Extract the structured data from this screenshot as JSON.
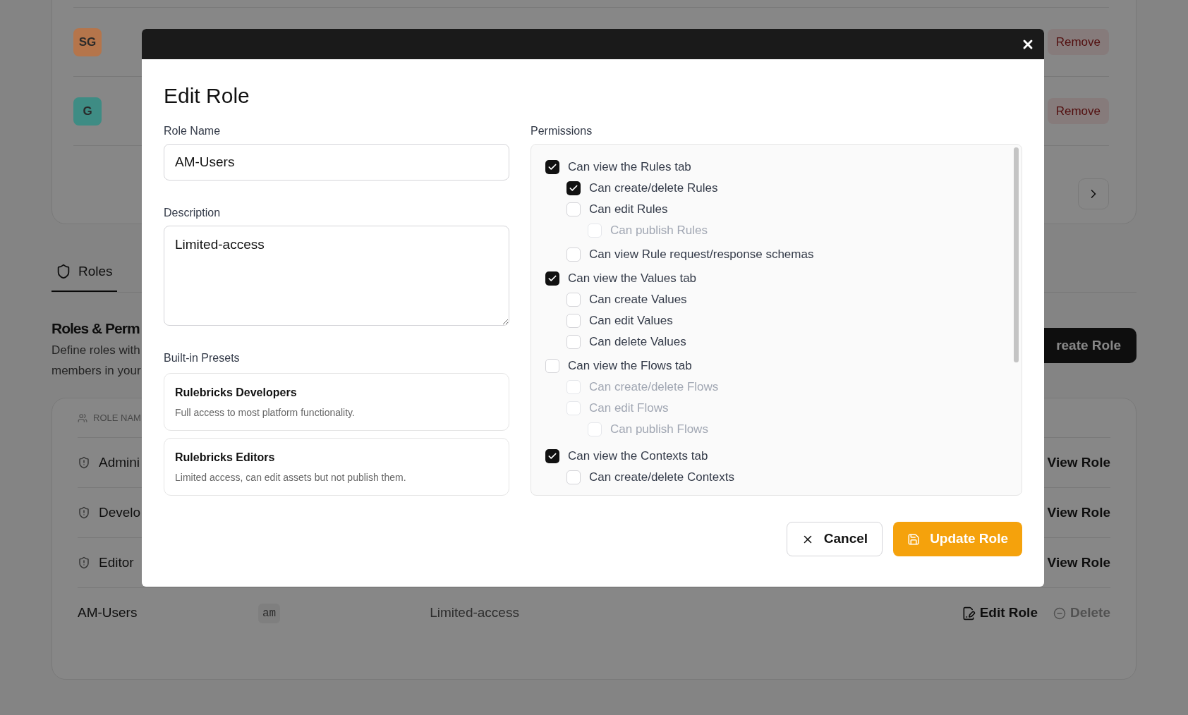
{
  "background": {
    "members": [
      {
        "initials": "SG",
        "color": "#b5754b",
        "action": "Remove"
      },
      {
        "initials": "G",
        "color": "#3e8c84",
        "action": "Remove"
      }
    ],
    "tabs": [
      {
        "label": "Roles",
        "selected": true
      }
    ],
    "section": {
      "title": "Roles & Perm",
      "description_lines": [
        "Define roles with",
        "members in your"
      ],
      "create_button": "reate Role"
    },
    "table": {
      "column_1": "ROLE NAM",
      "rows": [
        {
          "kind": "builtin",
          "name": "Admini",
          "action": "View Role"
        },
        {
          "kind": "builtin",
          "name": "Develo",
          "action": "View Role"
        },
        {
          "kind": "builtin",
          "name": "Editor",
          "action": "View Role"
        },
        {
          "kind": "custom",
          "name": "AM-Users",
          "slug": "am",
          "description": "Limited-access",
          "edit": "Edit Role",
          "delete": "Delete"
        }
      ]
    }
  },
  "modal": {
    "title": "Edit Role",
    "role_name": {
      "label": "Role Name",
      "value": "AM-Users"
    },
    "description": {
      "label": "Description",
      "value": "Limited-access"
    },
    "presets": {
      "label": "Built-in Presets",
      "items": [
        {
          "name": "Rulebricks Developers",
          "description": "Full access to most platform functionality."
        },
        {
          "name": "Rulebricks Editors",
          "description": "Limited access, can edit assets but not publish them."
        }
      ]
    },
    "permissions": {
      "label": "Permissions",
      "items": [
        {
          "label": "Can view the Rules tab",
          "checked": true,
          "disabled": false,
          "children": [
            {
              "label": "Can create/delete Rules",
              "checked": true,
              "disabled": false
            },
            {
              "label": "Can edit Rules",
              "checked": false,
              "disabled": false,
              "children": [
                {
                  "label": "Can publish Rules",
                  "checked": false,
                  "disabled": true
                }
              ]
            },
            {
              "label": "Can view Rule request/response schemas",
              "checked": false,
              "disabled": false
            }
          ]
        },
        {
          "label": "Can view the Values tab",
          "checked": true,
          "disabled": false,
          "children": [
            {
              "label": "Can create Values",
              "checked": false,
              "disabled": false
            },
            {
              "label": "Can edit Values",
              "checked": false,
              "disabled": false
            },
            {
              "label": "Can delete Values",
              "checked": false,
              "disabled": false
            }
          ]
        },
        {
          "label": "Can view the Flows tab",
          "checked": false,
          "disabled": false,
          "children": [
            {
              "label": "Can create/delete Flows",
              "checked": false,
              "disabled": true
            },
            {
              "label": "Can edit Flows",
              "checked": false,
              "disabled": true,
              "children": [
                {
                  "label": "Can publish Flows",
                  "checked": false,
                  "disabled": true
                }
              ]
            }
          ]
        },
        {
          "label": "Can view the Contexts tab",
          "checked": true,
          "disabled": false,
          "children": [
            {
              "label": "Can create/delete Contexts",
              "checked": false,
              "disabled": false
            }
          ]
        }
      ]
    },
    "buttons": {
      "cancel": "Cancel",
      "submit": "Update Role"
    }
  }
}
